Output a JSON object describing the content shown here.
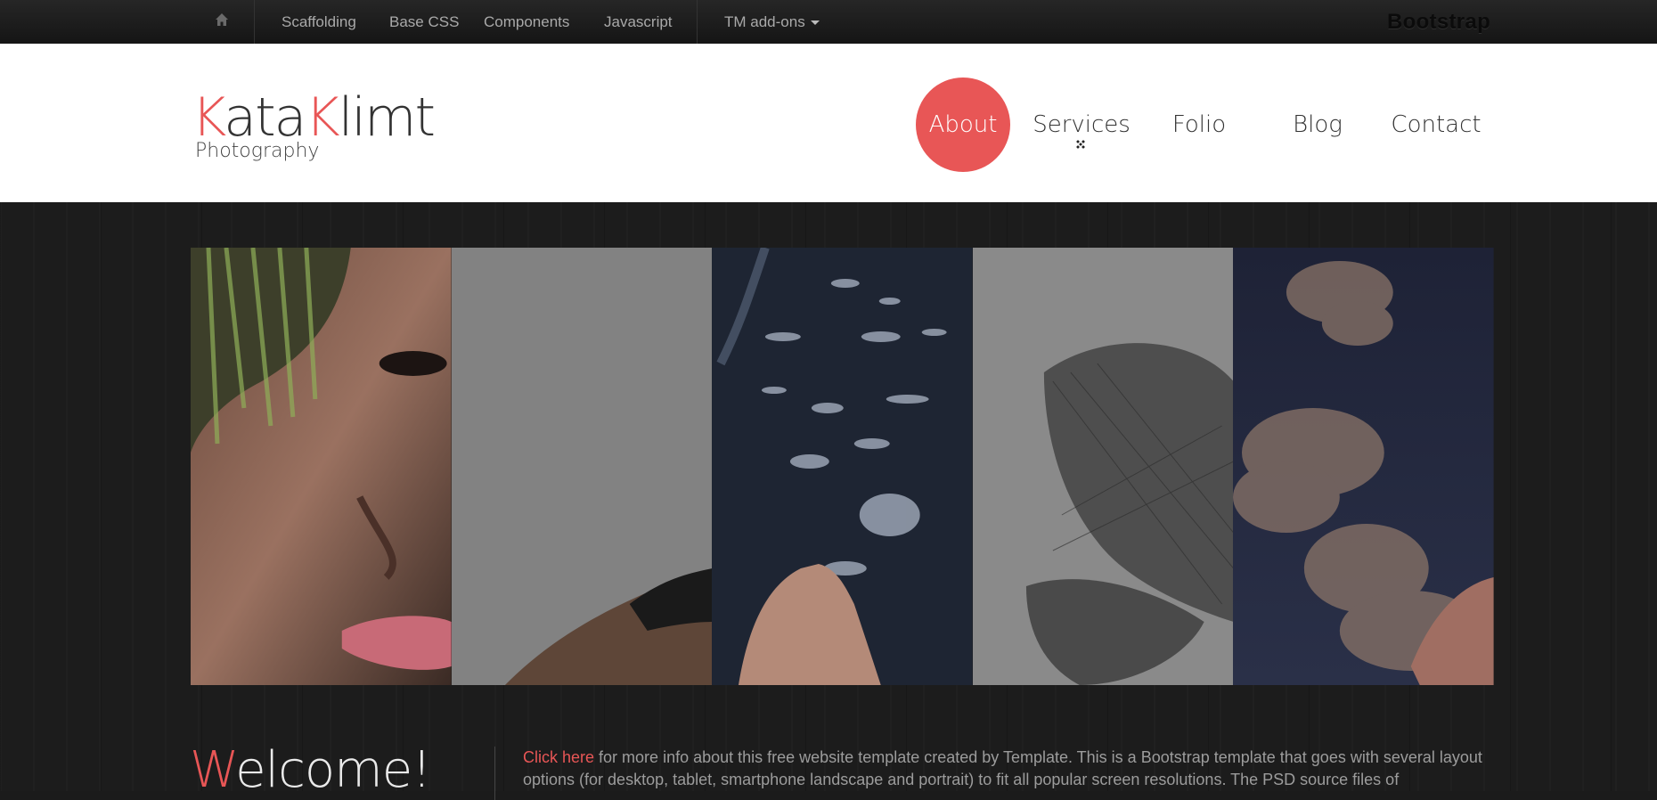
{
  "topbar": {
    "home_icon": "home-icon",
    "links": [
      "Scaffolding",
      "Base CSS",
      "Components",
      "Javascript"
    ],
    "addons_label": "TM add-ons",
    "brand": "Bootstrap"
  },
  "logo": {
    "first_initial": "K",
    "first_rest": "ata",
    "last_initial": "K",
    "last_rest": "limt",
    "subtitle": "Photography"
  },
  "nav": {
    "items": [
      "About",
      "Services",
      "Folio",
      "Blog",
      "Contact"
    ],
    "active": "About"
  },
  "gallery": {
    "panels": [
      "woman-face-photo",
      "shoulder-photo",
      "feathers-hand-photo",
      "veil-photo",
      "clouds-photo"
    ]
  },
  "welcome": {
    "heading_initial": "W",
    "heading_rest": "elcome!",
    "link_text": "Click here",
    "text": "for more info about this free website template created by Template. This is a Bootstrap template that goes with several layout options (for desktop, tablet, smartphone landscape and portrait) to fit all popular screen resolutions. The PSD source files of"
  },
  "colors": {
    "accent": "#e85656",
    "topbar": "#1f1f1f",
    "background": "#1c1c1c"
  }
}
